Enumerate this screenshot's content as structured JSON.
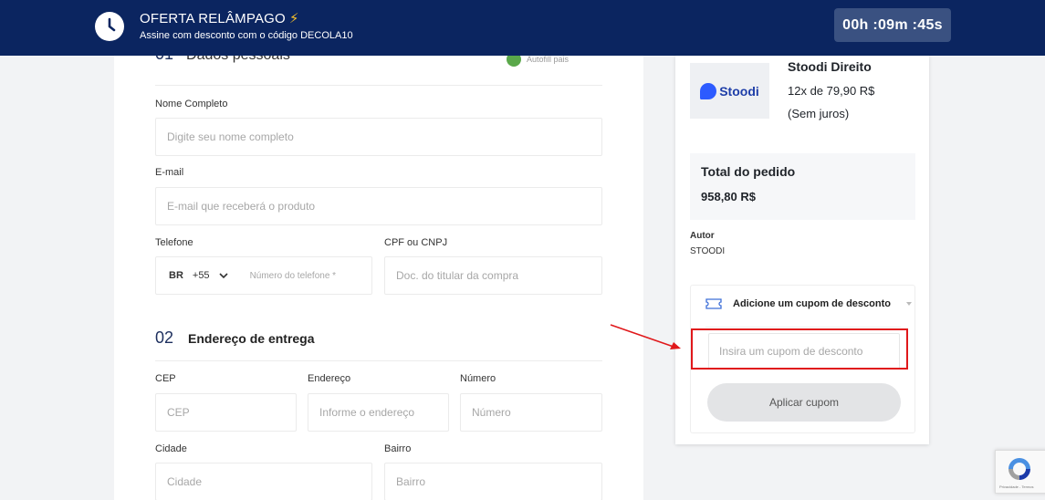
{
  "banner": {
    "title": "OFERTA RELÂMPAGO",
    "bolt": "⚡",
    "subtitle": "Assine com desconto com o código DECOLA10",
    "timer": "00h :09m :45s",
    "icon": "clock-icon"
  },
  "form": {
    "section1": {
      "number": "01",
      "title": "Dados pessoais",
      "autofill": "Autofill pais"
    },
    "full_name": {
      "label": "Nome Completo",
      "placeholder": "Digite seu nome completo"
    },
    "email": {
      "label": "E-mail",
      "placeholder": "E-mail que receberá o produto"
    },
    "phone": {
      "label": "Telefone",
      "country": "BR",
      "code": "+55",
      "placeholder": "Número do telefone *"
    },
    "cpf": {
      "label": "CPF ou CNPJ",
      "placeholder": "Doc. do titular da compra"
    },
    "section2": {
      "number": "02",
      "title": "Endereço de entrega"
    },
    "cep": {
      "label": "CEP",
      "placeholder": "CEP"
    },
    "address": {
      "label": "Endereço",
      "placeholder": "Informe o endereço"
    },
    "number": {
      "label": "Número",
      "placeholder": "Número"
    },
    "city": {
      "label": "Cidade",
      "placeholder": "Cidade"
    },
    "district": {
      "label": "Bairro",
      "placeholder": "Bairro"
    }
  },
  "summary": {
    "brand": "Stoodi",
    "product_name": "Stoodi Direito",
    "price": "12x de 79,90 R$",
    "terms": "(Sem juros)",
    "total_label": "Total do pedido",
    "total_value": "958,80 R$",
    "author_label": "Autor",
    "author_value": "STOODI",
    "coupon": {
      "toggle_label": "Adicione um cupom de desconto",
      "input_placeholder": "Insira um cupom de desconto",
      "apply_label": "Aplicar cupom"
    }
  },
  "recaptcha": {
    "text": "Privacidade - Termos"
  },
  "colors": {
    "banner": "#0b2560",
    "accent": "#1d2f5e",
    "highlight": "#e0181b"
  }
}
